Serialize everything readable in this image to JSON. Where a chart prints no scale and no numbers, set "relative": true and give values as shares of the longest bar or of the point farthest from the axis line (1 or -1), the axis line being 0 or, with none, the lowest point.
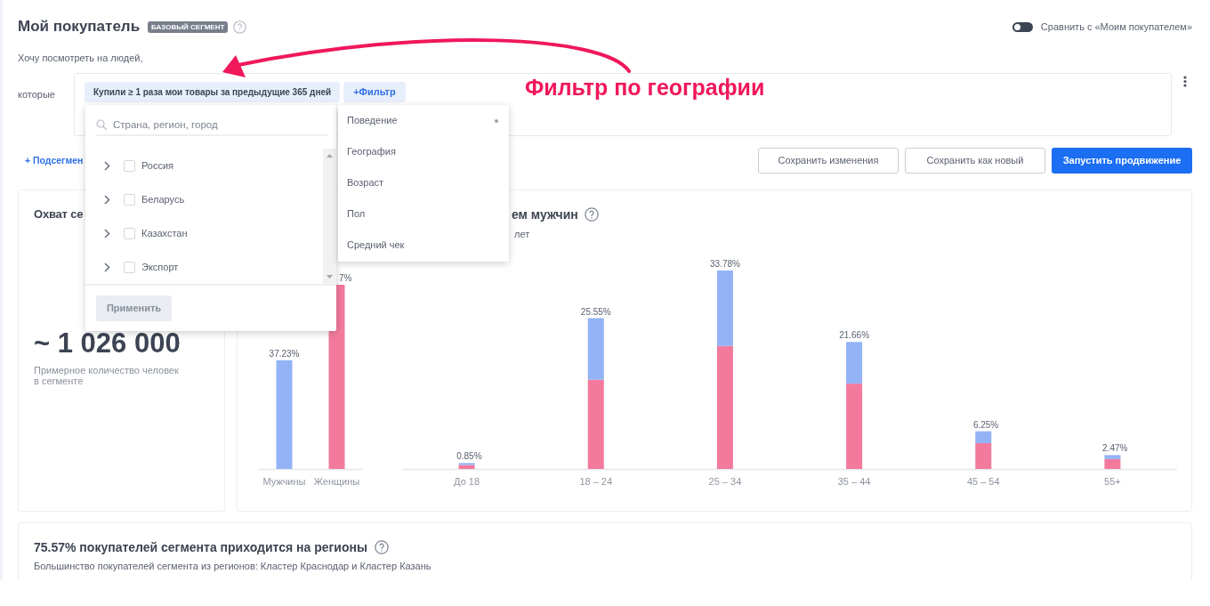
{
  "header": {
    "title": "Мой покупатель",
    "badge": "БАЗОВЫЙ СЕГМЕНТ",
    "compare_toggle": {
      "on": false,
      "label": "Сравнить с «Моим покупателем»"
    }
  },
  "intro": "Хочу посмотреть на людей,",
  "filter_row": {
    "label": "которые",
    "chips": [
      {
        "kind": "condition",
        "text": "Купили ≥ 1 раза мои товары за предыдущие 365 дней"
      },
      {
        "kind": "add",
        "text": "+Фильтр"
      }
    ]
  },
  "subsegment_link": "+ Подсегмен",
  "actions": [
    {
      "kind": "secondary",
      "label": "Сохранить изменения"
    },
    {
      "kind": "secondary",
      "label": "Сохранить как новый"
    },
    {
      "kind": "primary",
      "label": "Запустить продвижение"
    }
  ],
  "reach_card": {
    "title": "Охват се",
    "value": "~ 1 026 000",
    "caption": "Примерное количество человек в сегменте"
  },
  "demographics_card": {
    "title": "ем мужчин",
    "subtitle": "лет",
    "gender_chart": {
      "bar_labels": [
        "37.23%",
        "7%"
      ],
      "chart_data": {
        "type": "bar",
        "relative": true,
        "categories": [
          "Мужчины",
          "Женщины"
        ],
        "stacked": true,
        "series": [
          {
            "color": "#93b3f6",
            "values": [
              0.59,
              null
            ]
          },
          {
            "color": "#f37a9d",
            "values": [
              null,
              1.0
            ]
          }
        ]
      }
    },
    "age_chart": {
      "bar_labels": [
        "0.85%",
        "25.55%",
        "33.78%",
        "21.66%",
        "6.25%",
        "2.47%"
      ],
      "chart_data": {
        "type": "bar",
        "relative": true,
        "categories": [
          "До 18",
          "18 – 24",
          "25 – 34",
          "35 – 44",
          "45 – 54",
          "55+"
        ],
        "stacked": true,
        "series": [
          {
            "color": "#f37a9d",
            "values": [
              0.02,
              0.45,
              0.62,
              0.43,
              0.13,
              0.05
            ]
          },
          {
            "color": "#93b3f6",
            "values": [
              0.01,
              0.31,
              0.38,
              0.21,
              0.06,
              0.02
            ]
          }
        ]
      }
    }
  },
  "regions_card": {
    "title": "75.57% покупателей сегмента приходится на регионы",
    "subtitle": "Большинство покупателей сегмента из регионов: Кластер Краснодар и Кластер Казань"
  },
  "location_dropdown": {
    "search": {
      "placeholder": "Страна, регион, город"
    },
    "items": [
      {
        "label": "Россия",
        "checked": false
      },
      {
        "label": "Беларусь",
        "checked": false
      },
      {
        "label": "Казахстан",
        "checked": false
      },
      {
        "label": "Экспорт",
        "checked": false
      }
    ],
    "apply_button": {
      "label": "Применить",
      "disabled": true
    }
  },
  "filter_menu": {
    "items": [
      {
        "label": "Поведение",
        "active": true
      },
      {
        "label": "География",
        "active": false
      },
      {
        "label": "Возраст",
        "active": false
      },
      {
        "label": "Пол",
        "active": false
      },
      {
        "label": "Средний чек",
        "active": false
      }
    ]
  },
  "annotation": {
    "text": "Фильтр по географии"
  }
}
